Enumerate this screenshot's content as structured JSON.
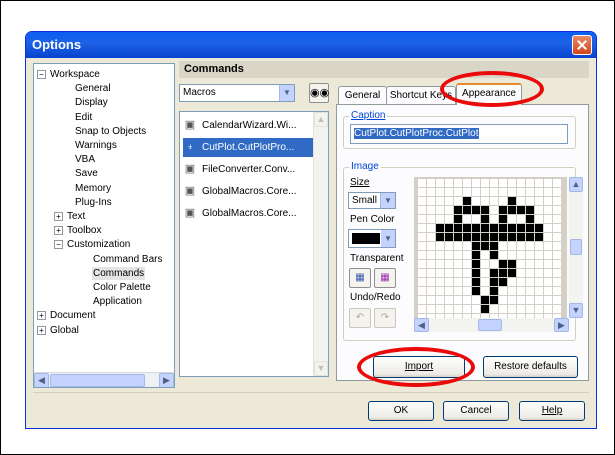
{
  "window": {
    "title": "Options"
  },
  "tree": {
    "items": [
      {
        "label": "Workspace",
        "level": 0,
        "expander": "−"
      },
      {
        "label": "General",
        "level": 1
      },
      {
        "label": "Display",
        "level": 1
      },
      {
        "label": "Edit",
        "level": 1
      },
      {
        "label": "Snap to Objects",
        "level": 1
      },
      {
        "label": "Warnings",
        "level": 1
      },
      {
        "label": "VBA",
        "level": 1
      },
      {
        "label": "Save",
        "level": 1
      },
      {
        "label": "Memory",
        "level": 1
      },
      {
        "label": "Plug-Ins",
        "level": 1
      },
      {
        "label": "Text",
        "level": 1,
        "expander": "+"
      },
      {
        "label": "Toolbox",
        "level": 1,
        "expander": "+"
      },
      {
        "label": "Customization",
        "level": 1,
        "expander": "−"
      },
      {
        "label": "Command Bars",
        "level": 2
      },
      {
        "label": "Commands",
        "level": 2,
        "selected": true
      },
      {
        "label": "Color Palette",
        "level": 2
      },
      {
        "label": "Application",
        "level": 2
      },
      {
        "label": "Document",
        "level": 0,
        "expander": "+"
      },
      {
        "label": "Global",
        "level": 0,
        "expander": "+"
      }
    ]
  },
  "commands": {
    "header": "Commands",
    "category": "Macros",
    "list": [
      {
        "label": "CalendarWizard.Wi...",
        "icon": "macro-icon"
      },
      {
        "label": "CutPlot.CutPlotPro...",
        "icon": "cutplot-icon",
        "selected": true
      },
      {
        "label": "FileConverter.Conv...",
        "icon": "macro-icon"
      },
      {
        "label": "GlobalMacros.Core...",
        "icon": "macro-icon"
      },
      {
        "label": "GlobalMacros.Core...",
        "icon": "macro-icon"
      }
    ]
  },
  "tabs": [
    {
      "label": "General"
    },
    {
      "label": "Shortcut Keys"
    },
    {
      "label": "Appearance",
      "active": true
    }
  ],
  "appearance": {
    "caption_label": "Caption",
    "caption_value": "CutPlot.CutPlotProc.CutPlot",
    "image_label": "Image",
    "size_label": "Size",
    "size_value": "Small",
    "pen_color_label": "Pen Color",
    "pen_color": "#000000",
    "transparent_label": "Transparent",
    "undo_redo_label": "Undo/Redo",
    "import_label": "Import",
    "restore_label": "Restore defaults"
  },
  "footer": {
    "ok_label": "OK",
    "cancel_label": "Cancel",
    "help_label": "Help"
  },
  "colors": {
    "title_bar": "#0a5ef2",
    "selection": "#316ac5",
    "highlight": "#ea0a0a"
  }
}
